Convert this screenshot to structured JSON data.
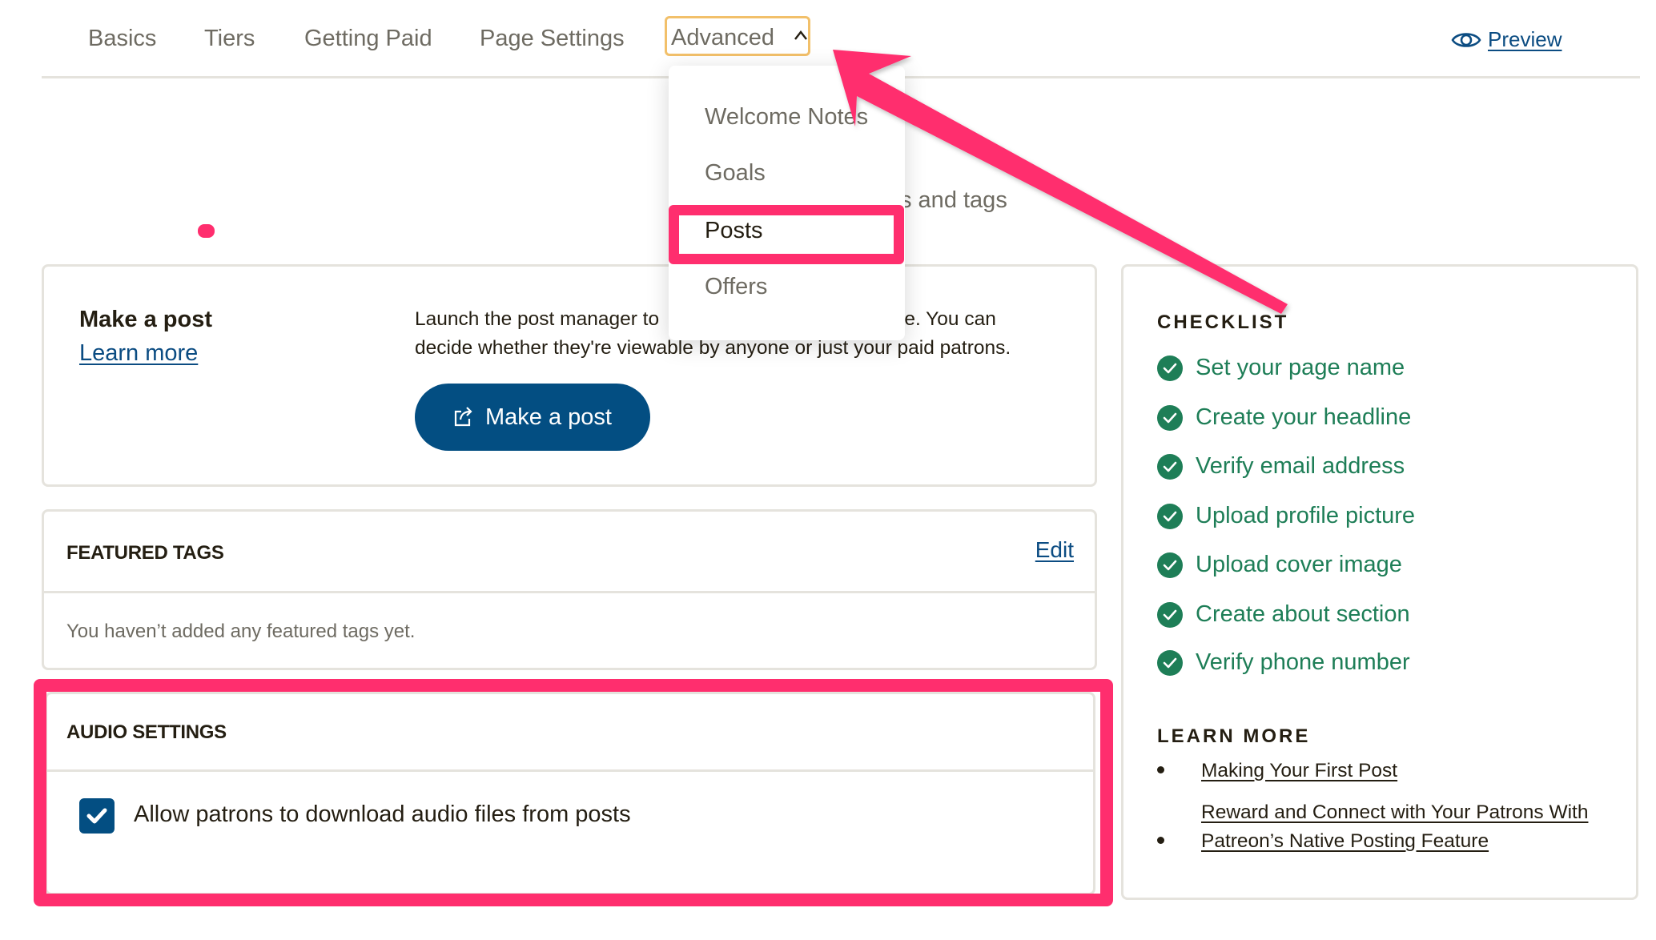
{
  "nav": {
    "tabs": [
      {
        "label": "Basics"
      },
      {
        "label": "Tiers"
      },
      {
        "label": "Getting Paid"
      },
      {
        "label": "Page Settings"
      },
      {
        "label": "Advanced",
        "expanded": true
      }
    ],
    "preview_label": "Preview",
    "preview_icon": "eye-icon"
  },
  "dropdown": {
    "items": [
      {
        "label": "Welcome Notes"
      },
      {
        "label": "Goals"
      },
      {
        "label": "Posts",
        "highlighted": true
      },
      {
        "label": "Offers"
      }
    ]
  },
  "partial_heading": "s and tags",
  "make_post": {
    "title": "Make a post",
    "learn_more": "Learn more",
    "description": "Launch the post manager to create posts on your creator page. You can decide whether they're viewable by anyone or just your paid patrons.",
    "description_line1_left": "Launch the post manager to",
    "description_line1_right": "tor page. You can",
    "description_line2": "decide whether they're viewable by anyone or just your paid patrons.",
    "button_label": "Make a post",
    "button_icon": "share-external-icon"
  },
  "featured_tags": {
    "title": "FEATURED TAGS",
    "edit_label": "Edit",
    "empty_text": "You haven’t added any featured tags yet."
  },
  "audio_settings": {
    "title": "AUDIO SETTINGS",
    "checkbox_label": "Allow patrons to download audio files from posts",
    "checked": true
  },
  "checklist": {
    "title": "CHECKLIST",
    "items": [
      {
        "label": "Set your page name",
        "done": true
      },
      {
        "label": "Create your headline",
        "done": true
      },
      {
        "label": "Verify email address",
        "done": true
      },
      {
        "label": "Upload profile picture",
        "done": true
      },
      {
        "label": "Upload cover image",
        "done": true
      },
      {
        "label": "Create about section",
        "done": true
      },
      {
        "label": "Verify phone number",
        "done": true
      }
    ]
  },
  "learn_more": {
    "title": "LEARN MORE",
    "links": [
      {
        "line1": "Making Your First Post"
      },
      {
        "line1": "Reward and Connect with Your Patrons With",
        "line2": "Patreon’s Native Posting Feature"
      }
    ]
  },
  "colors": {
    "accent_blue": "#034e82",
    "link_blue": "#0b4c82",
    "check_green": "#1e7e57",
    "annotation_pink": "#ff2e6e",
    "focus_orange": "#f2c06a"
  }
}
